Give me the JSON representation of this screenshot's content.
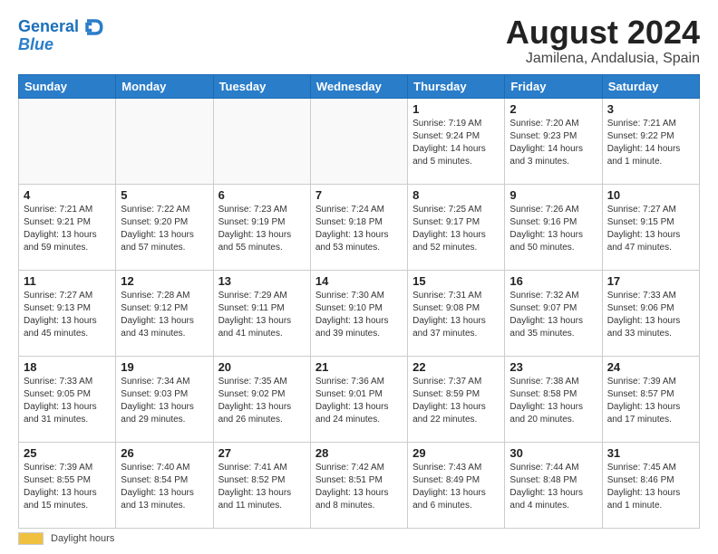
{
  "logo": {
    "line1": "General",
    "line2": "Blue"
  },
  "title": "August 2024",
  "subtitle": "Jamilena, Andalusia, Spain",
  "days_of_week": [
    "Sunday",
    "Monday",
    "Tuesday",
    "Wednesday",
    "Thursday",
    "Friday",
    "Saturday"
  ],
  "footer": {
    "label": "Daylight hours"
  },
  "weeks": [
    [
      {
        "day": "",
        "info": ""
      },
      {
        "day": "",
        "info": ""
      },
      {
        "day": "",
        "info": ""
      },
      {
        "day": "",
        "info": ""
      },
      {
        "day": "1",
        "info": "Sunrise: 7:19 AM\nSunset: 9:24 PM\nDaylight: 14 hours\nand 5 minutes."
      },
      {
        "day": "2",
        "info": "Sunrise: 7:20 AM\nSunset: 9:23 PM\nDaylight: 14 hours\nand 3 minutes."
      },
      {
        "day": "3",
        "info": "Sunrise: 7:21 AM\nSunset: 9:22 PM\nDaylight: 14 hours\nand 1 minute."
      }
    ],
    [
      {
        "day": "4",
        "info": "Sunrise: 7:21 AM\nSunset: 9:21 PM\nDaylight: 13 hours\nand 59 minutes."
      },
      {
        "day": "5",
        "info": "Sunrise: 7:22 AM\nSunset: 9:20 PM\nDaylight: 13 hours\nand 57 minutes."
      },
      {
        "day": "6",
        "info": "Sunrise: 7:23 AM\nSunset: 9:19 PM\nDaylight: 13 hours\nand 55 minutes."
      },
      {
        "day": "7",
        "info": "Sunrise: 7:24 AM\nSunset: 9:18 PM\nDaylight: 13 hours\nand 53 minutes."
      },
      {
        "day": "8",
        "info": "Sunrise: 7:25 AM\nSunset: 9:17 PM\nDaylight: 13 hours\nand 52 minutes."
      },
      {
        "day": "9",
        "info": "Sunrise: 7:26 AM\nSunset: 9:16 PM\nDaylight: 13 hours\nand 50 minutes."
      },
      {
        "day": "10",
        "info": "Sunrise: 7:27 AM\nSunset: 9:15 PM\nDaylight: 13 hours\nand 47 minutes."
      }
    ],
    [
      {
        "day": "11",
        "info": "Sunrise: 7:27 AM\nSunset: 9:13 PM\nDaylight: 13 hours\nand 45 minutes."
      },
      {
        "day": "12",
        "info": "Sunrise: 7:28 AM\nSunset: 9:12 PM\nDaylight: 13 hours\nand 43 minutes."
      },
      {
        "day": "13",
        "info": "Sunrise: 7:29 AM\nSunset: 9:11 PM\nDaylight: 13 hours\nand 41 minutes."
      },
      {
        "day": "14",
        "info": "Sunrise: 7:30 AM\nSunset: 9:10 PM\nDaylight: 13 hours\nand 39 minutes."
      },
      {
        "day": "15",
        "info": "Sunrise: 7:31 AM\nSunset: 9:08 PM\nDaylight: 13 hours\nand 37 minutes."
      },
      {
        "day": "16",
        "info": "Sunrise: 7:32 AM\nSunset: 9:07 PM\nDaylight: 13 hours\nand 35 minutes."
      },
      {
        "day": "17",
        "info": "Sunrise: 7:33 AM\nSunset: 9:06 PM\nDaylight: 13 hours\nand 33 minutes."
      }
    ],
    [
      {
        "day": "18",
        "info": "Sunrise: 7:33 AM\nSunset: 9:05 PM\nDaylight: 13 hours\nand 31 minutes."
      },
      {
        "day": "19",
        "info": "Sunrise: 7:34 AM\nSunset: 9:03 PM\nDaylight: 13 hours\nand 29 minutes."
      },
      {
        "day": "20",
        "info": "Sunrise: 7:35 AM\nSunset: 9:02 PM\nDaylight: 13 hours\nand 26 minutes."
      },
      {
        "day": "21",
        "info": "Sunrise: 7:36 AM\nSunset: 9:01 PM\nDaylight: 13 hours\nand 24 minutes."
      },
      {
        "day": "22",
        "info": "Sunrise: 7:37 AM\nSunset: 8:59 PM\nDaylight: 13 hours\nand 22 minutes."
      },
      {
        "day": "23",
        "info": "Sunrise: 7:38 AM\nSunset: 8:58 PM\nDaylight: 13 hours\nand 20 minutes."
      },
      {
        "day": "24",
        "info": "Sunrise: 7:39 AM\nSunset: 8:57 PM\nDaylight: 13 hours\nand 17 minutes."
      }
    ],
    [
      {
        "day": "25",
        "info": "Sunrise: 7:39 AM\nSunset: 8:55 PM\nDaylight: 13 hours\nand 15 minutes."
      },
      {
        "day": "26",
        "info": "Sunrise: 7:40 AM\nSunset: 8:54 PM\nDaylight: 13 hours\nand 13 minutes."
      },
      {
        "day": "27",
        "info": "Sunrise: 7:41 AM\nSunset: 8:52 PM\nDaylight: 13 hours\nand 11 minutes."
      },
      {
        "day": "28",
        "info": "Sunrise: 7:42 AM\nSunset: 8:51 PM\nDaylight: 13 hours\nand 8 minutes."
      },
      {
        "day": "29",
        "info": "Sunrise: 7:43 AM\nSunset: 8:49 PM\nDaylight: 13 hours\nand 6 minutes."
      },
      {
        "day": "30",
        "info": "Sunrise: 7:44 AM\nSunset: 8:48 PM\nDaylight: 13 hours\nand 4 minutes."
      },
      {
        "day": "31",
        "info": "Sunrise: 7:45 AM\nSunset: 8:46 PM\nDaylight: 13 hours\nand 1 minute."
      }
    ]
  ]
}
